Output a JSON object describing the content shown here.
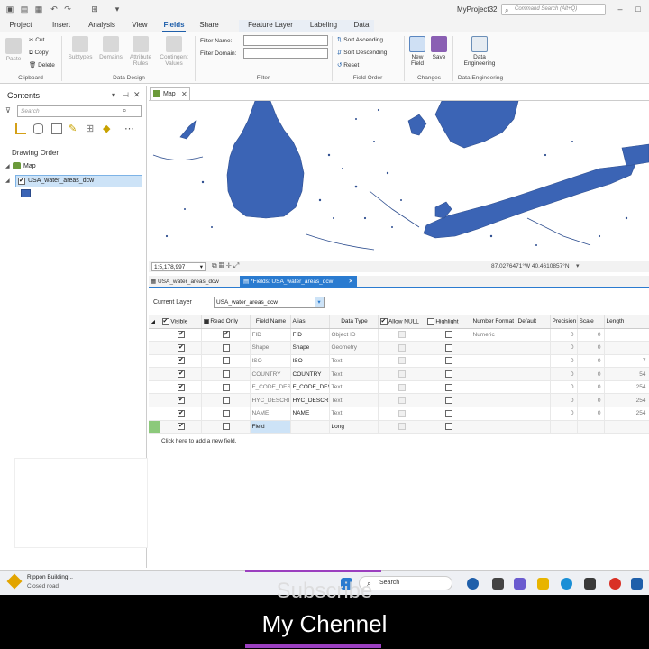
{
  "app": {
    "title": "MyProject32"
  },
  "search": {
    "placeholder": "Command Search (Alt+Q)"
  },
  "tabs": [
    {
      "label": "Project"
    },
    {
      "label": "Insert"
    },
    {
      "label": "Analysis"
    },
    {
      "label": "View"
    },
    {
      "label": "Fields"
    },
    {
      "label": "Share"
    },
    {
      "label": "Feature Layer"
    },
    {
      "label": "Labeling"
    },
    {
      "label": "Data"
    }
  ],
  "ribbon": {
    "clipboard": {
      "paste": "Paste",
      "cut": "Cut",
      "copy": "Copy",
      "delete": "Delete",
      "group": "Clipboard"
    },
    "data_design": {
      "subtypes": "Subtypes",
      "domains": "Domains",
      "attribute": "Attribute",
      "rules": "Rules",
      "contingent": "Contingent",
      "values": "Values",
      "group": "Data Design"
    },
    "filter": {
      "name_label": "Filter Name:",
      "domain_label": "Filter Domain:",
      "group": "Filter"
    },
    "field_order": {
      "asc": "Sort Ascending",
      "desc": "Sort Descending",
      "reset": "Reset",
      "group": "Field Order"
    },
    "changes": {
      "new": "New",
      "field": "Field",
      "save": "Save",
      "group": "Changes"
    },
    "data_engineering": {
      "line1": "Data",
      "line2": "Engineering",
      "group": "Data Engineering"
    }
  },
  "contents": {
    "title": "Contents",
    "search_placeholder": "Search",
    "drawing_order": "Drawing Order",
    "map": "Map",
    "layer": "USA_water_areas_dcw"
  },
  "map_view": {
    "tab": "Map",
    "scale": "1:5,178,997",
    "coords": "87.0276471°W 40.4610857°N"
  },
  "fields_view": {
    "tab1": "USA_water_areas_dcw",
    "tab2": "*Fields: USA_water_areas_dcw",
    "current_layer_label": "Current Layer",
    "current_layer_value": "USA_water_areas_dcw",
    "columns": [
      "Visible",
      "Read Only",
      "Field Name",
      "Alias",
      "Data Type",
      "Allow NULL",
      "Highlight",
      "Number Format",
      "Default",
      "Precision",
      "Scale",
      "Length"
    ],
    "rows": [
      {
        "visible": true,
        "readonly": true,
        "name": "FID",
        "alias": "FID",
        "type": "Object ID",
        "format": "Numeric",
        "precision": "0",
        "scale": "0",
        "length": ""
      },
      {
        "visible": true,
        "readonly": false,
        "name": "Shape",
        "alias": "Shape",
        "type": "Geometry",
        "format": "",
        "precision": "0",
        "scale": "0",
        "length": ""
      },
      {
        "visible": true,
        "readonly": false,
        "name": "ISO",
        "alias": "ISO",
        "type": "Text",
        "format": "",
        "precision": "0",
        "scale": "0",
        "length": "7"
      },
      {
        "visible": true,
        "readonly": false,
        "name": "COUNTRY",
        "alias": "COUNTRY",
        "type": "Text",
        "format": "",
        "precision": "0",
        "scale": "0",
        "length": "54"
      },
      {
        "visible": true,
        "readonly": false,
        "name": "F_CODE_DES",
        "alias": "F_CODE_DES",
        "type": "Text",
        "format": "",
        "precision": "0",
        "scale": "0",
        "length": "254"
      },
      {
        "visible": true,
        "readonly": false,
        "name": "HYC_DESCRI",
        "alias": "HYC_DESCRI",
        "type": "Text",
        "format": "",
        "precision": "0",
        "scale": "0",
        "length": "254"
      },
      {
        "visible": true,
        "readonly": false,
        "name": "NAME",
        "alias": "NAME",
        "type": "Text",
        "format": "",
        "precision": "0",
        "scale": "0",
        "length": "254"
      },
      {
        "visible": true,
        "readonly": false,
        "name": "Field",
        "alias": "",
        "type": "Long",
        "format": "",
        "precision": "",
        "scale": "",
        "length": ""
      }
    ],
    "add_field": "Click here to add a new field."
  },
  "taskbar": {
    "weather_title": "Rippon Building...",
    "weather_sub": "Closed road",
    "search": "Search"
  },
  "overlay": {
    "line1": "Subscribe",
    "line2": "My Chennel"
  },
  "colors": {
    "accent": "#1f5faa",
    "water": "#3b64b5",
    "overlay_purple": "#9b3fbf"
  }
}
